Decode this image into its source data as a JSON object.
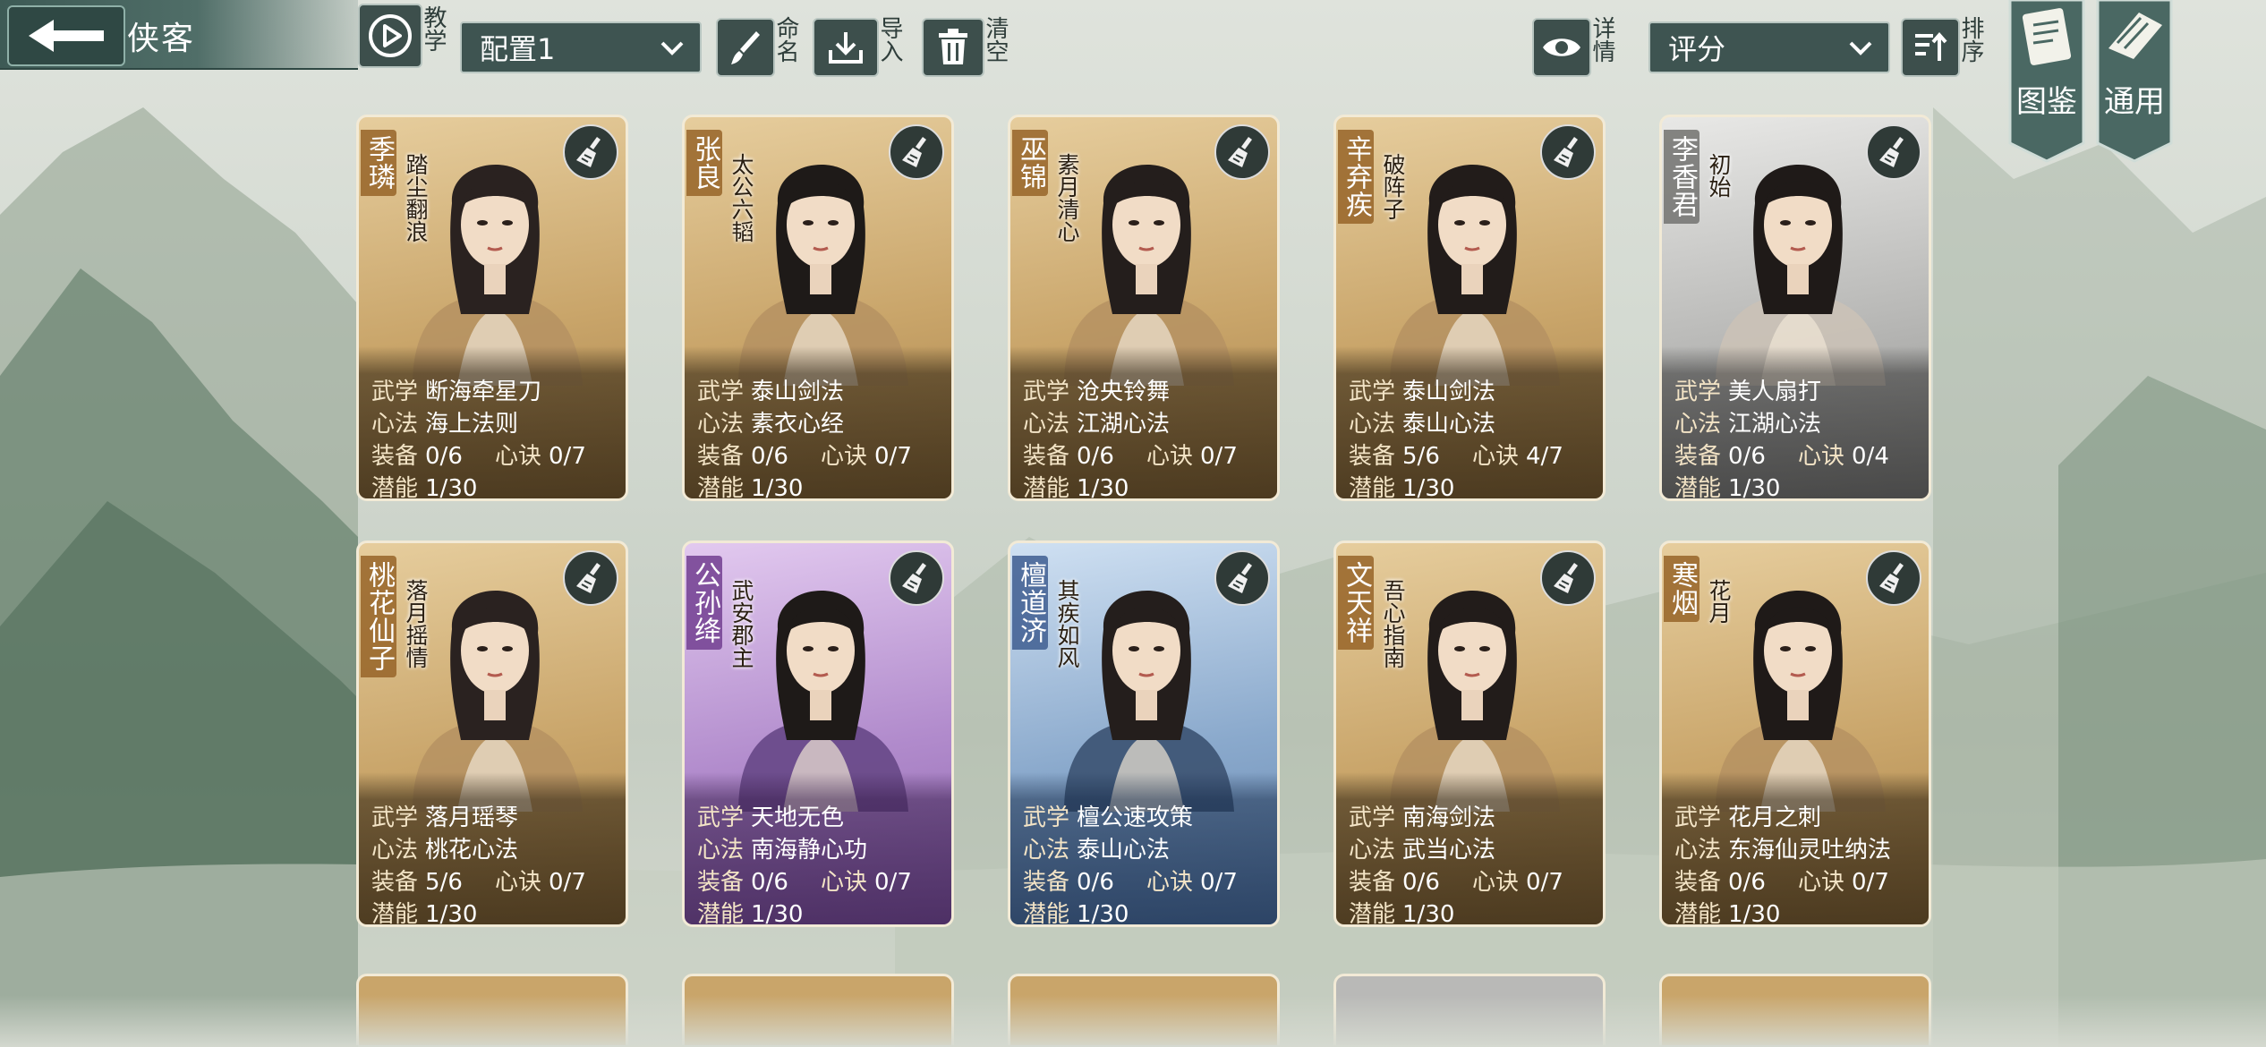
{
  "header": {
    "title": "侠客",
    "tutorial_label": "教学",
    "config_select": "配置1",
    "rename_label": "命名",
    "import_label": "导入",
    "clear_label": "清空",
    "details_label": "详情",
    "sort_select": "评分",
    "sort_label": "排序",
    "gallery_label": "图鉴",
    "general_label": "通用"
  },
  "labels": {
    "martial": "武学",
    "mental": "心法",
    "equip": "装备",
    "secret": "心诀",
    "potential": "潜能"
  },
  "cards": [
    {
      "name": "季璘",
      "epithet": "踏尘翻浪",
      "martial": "断海牵星刀",
      "mental": "海上法则",
      "equip": "0/6",
      "secret": "0/7",
      "potential": "1/30",
      "rarity": "gold"
    },
    {
      "name": "张良",
      "epithet": "太公六韬",
      "martial": "泰山剑法",
      "mental": "素衣心经",
      "equip": "0/6",
      "secret": "0/7",
      "potential": "1/30",
      "rarity": "gold"
    },
    {
      "name": "巫锦",
      "epithet": "素月清心",
      "martial": "沧央铃舞",
      "mental": "江湖心法",
      "equip": "0/6",
      "secret": "0/7",
      "potential": "1/30",
      "rarity": "gold"
    },
    {
      "name": "辛弃疾",
      "epithet": "破阵子",
      "martial": "泰山剑法",
      "mental": "泰山心法",
      "equip": "5/6",
      "secret": "4/7",
      "potential": "1/30",
      "rarity": "gold"
    },
    {
      "name": "李香君",
      "epithet": "初始",
      "martial": "美人扇打",
      "mental": "江湖心法",
      "equip": "0/6",
      "secret": "0/4",
      "potential": "1/30",
      "rarity": "gray"
    },
    {
      "name": "桃花仙子",
      "epithet": "落月摇情",
      "martial": "落月瑶琴",
      "mental": "桃花心法",
      "equip": "5/6",
      "secret": "0/7",
      "potential": "1/30",
      "rarity": "gold"
    },
    {
      "name": "公孙绛",
      "epithet": "武安郡主",
      "martial": "天地无色",
      "mental": "南海静心功",
      "equip": "0/6",
      "secret": "0/7",
      "potential": "1/30",
      "rarity": "purple"
    },
    {
      "name": "檀道济",
      "epithet": "其疾如风",
      "martial": "檀公速攻策",
      "mental": "泰山心法",
      "equip": "0/6",
      "secret": "0/7",
      "potential": "1/30",
      "rarity": "blue"
    },
    {
      "name": "文天祥",
      "epithet": "吾心指南",
      "martial": "南海剑法",
      "mental": "武当心法",
      "equip": "0/6",
      "secret": "0/7",
      "potential": "1/30",
      "rarity": "gold"
    },
    {
      "name": "寒烟",
      "epithet": "花月",
      "martial": "花月之刺",
      "mental": "东海仙灵吐纳法",
      "equip": "0/6",
      "secret": "0/7",
      "potential": "1/30",
      "rarity": "gold"
    }
  ],
  "partial_row_rarities": [
    "gold",
    "gold",
    "gold",
    "gray",
    "gold"
  ],
  "colors": {
    "gold": "#c9a56a",
    "gray": "#b9b9b7",
    "purple": "#b18bcc",
    "blue": "#8aa9cc",
    "bar": "#3e5451"
  }
}
